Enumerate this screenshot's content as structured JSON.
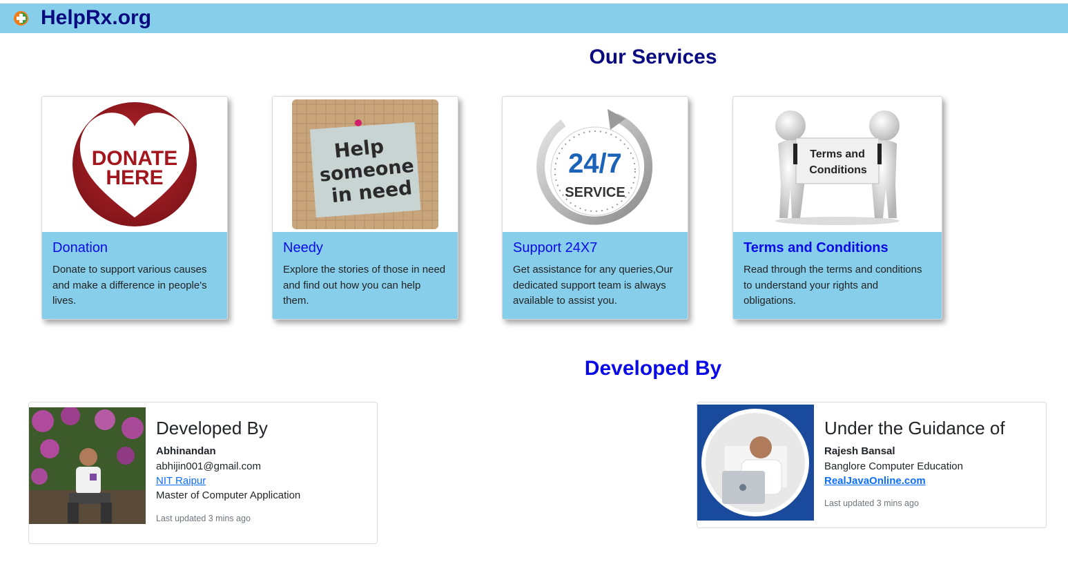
{
  "brand": {
    "name": "HelpRx.org",
    "icon": "plus-circle-icon"
  },
  "services": {
    "heading": "Our Services",
    "cards": [
      {
        "title": "Donation",
        "text": "Donate to support various causes and make a difference in people's lives.",
        "image_text": [
          "DONATE",
          "HERE"
        ]
      },
      {
        "title": "Needy",
        "text": "Explore the stories of those in need and find out how you can help them.",
        "image_text": [
          "Help",
          "someone",
          "in need"
        ]
      },
      {
        "title": "Support 24X7",
        "text": "Get assistance for any queries,Our dedicated support team is always available to assist you.",
        "image_text": [
          "24/7",
          "SERVICE"
        ]
      },
      {
        "title": "Terms and Conditions",
        "text": "Read through the terms and conditions to understand your rights and obligations.",
        "image_text": [
          "Terms and",
          "Conditions"
        ]
      }
    ]
  },
  "developers": {
    "heading": "Developed By",
    "profiles": [
      {
        "heading": "Developed By",
        "name": "Abhinandan",
        "email": "abhijin001@gmail.com",
        "link": "NIT Raipur",
        "detail": "Master of Computer Application",
        "updated": "Last updated 3 mins ago"
      },
      {
        "heading": "Under the Guidance of",
        "name": "Rajesh Bansal",
        "org": "Banglore Computer Education",
        "link": "RealJavaOnline.com",
        "updated": "Last updated 3 mins ago"
      }
    ]
  },
  "colors": {
    "navbar": "#87ceeb",
    "brand_text": "#0a0a80",
    "card_title": "#0a0ae6",
    "link": "#0d6efd"
  }
}
